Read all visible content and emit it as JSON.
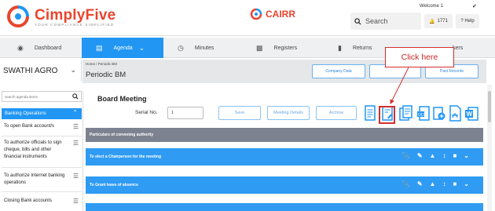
{
  "header": {
    "brand": "CimplyFive",
    "tagline": "YOUR COMPLIANCE SIMPLIFIED",
    "product": "CAIRR",
    "search_placeholder": "Search",
    "welcome": "Welcome 1",
    "notification_count": "1771",
    "help_label": "? Help"
  },
  "nav": {
    "items": [
      {
        "label": "Dashboard",
        "icon": "dashboard-icon"
      },
      {
        "label": "Agenda",
        "icon": "agenda-icon",
        "active": true
      },
      {
        "label": "Minutes",
        "icon": "clock-icon"
      },
      {
        "label": "Registers",
        "icon": "folder-icon"
      },
      {
        "label": "Returns",
        "icon": "file-icon"
      },
      {
        "label": "kers",
        "icon": "tracker-icon"
      }
    ]
  },
  "company": {
    "name": "SWATHI AGRO"
  },
  "page": {
    "breadcrumb": "Home  /  Periodic BM",
    "title": "Periodic BM",
    "buttons": [
      "Company Data",
      "",
      "Past Records"
    ]
  },
  "sidebar": {
    "search_placeholder": "search agenda items",
    "group": "Banking Operations",
    "items": [
      "To open Bank account/s",
      "To authorize officials to sign cheque, bills and other financial instruments",
      "To authorize Internet banking operations",
      "Closing Bank accounts"
    ]
  },
  "main": {
    "title": "Board Meeting",
    "serial_label": "Serial No.",
    "serial_value": "1",
    "actions": [
      "Save",
      "Meeting Details",
      "Archive"
    ],
    "section": "Particulars of convening authority",
    "rows": [
      "To elect a Chairperson for the meeting",
      "To Grant leave of absence"
    ]
  },
  "callout": {
    "text": "Click here"
  },
  "colors": {
    "brand_red": "#e8452c",
    "accent_blue": "#2196f3",
    "row_blue": "#2f9bf3",
    "section_grey": "#7d8290"
  }
}
